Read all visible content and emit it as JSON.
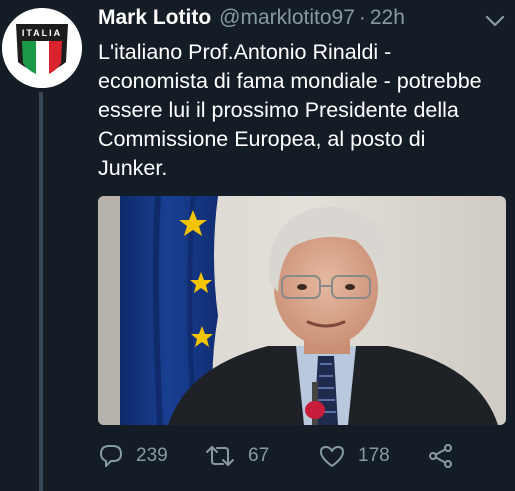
{
  "tweet": {
    "author": {
      "display_name": "Mark Lotito",
      "handle": "@marklotito97",
      "avatar_text": "ITALIA",
      "avatar_icon": "italian-flag-shield"
    },
    "separator": "·",
    "time": "22h",
    "text": "L'italiano Prof.Antonio Rinaldi - economista di fama mondiale - potrebbe essere lui il prossimo Presidente della Commissione Europea, al posto di Junker.",
    "media": {
      "icon": "photo-man-with-eu-flag"
    },
    "actions": {
      "reply_count": "239",
      "retweet_count": "67",
      "like_count": "178",
      "icons": [
        "reply-icon",
        "retweet-icon",
        "like-icon",
        "share-icon"
      ]
    }
  },
  "colors": {
    "background": "#141d26",
    "muted": "#8899a6",
    "text": "#ffffff",
    "thread_line": "#3a4754"
  }
}
